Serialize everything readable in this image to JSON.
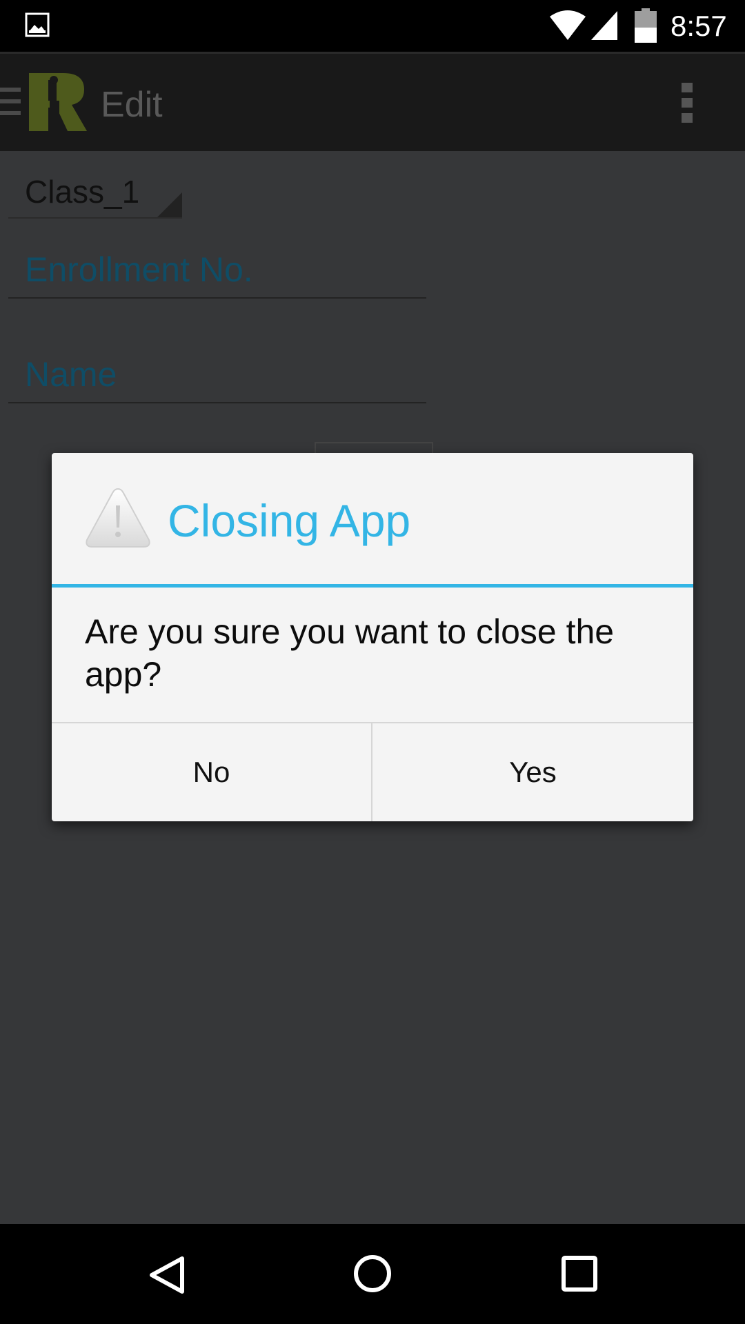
{
  "status_bar": {
    "time": "8:57",
    "icons": [
      "image-notification-icon",
      "wifi-icon",
      "signal-icon",
      "battery-icon"
    ]
  },
  "action_bar": {
    "title": "Edit",
    "icons": [
      "drawer-menu-icon",
      "app-logo-icon",
      "overflow-menu-icon"
    ]
  },
  "form": {
    "class_spinner_value": "Class_1",
    "enrollment_hint": "Enrollment No.",
    "name_hint": "Name"
  },
  "dialog": {
    "title": "Closing App",
    "icon": "warning-icon",
    "message": "Are you sure you want to close the app?",
    "negative_label": "No",
    "positive_label": "Yes",
    "accent_color": "#33b5e5"
  },
  "nav_bar": {
    "icons": [
      "back-icon",
      "home-icon",
      "recents-icon"
    ]
  }
}
